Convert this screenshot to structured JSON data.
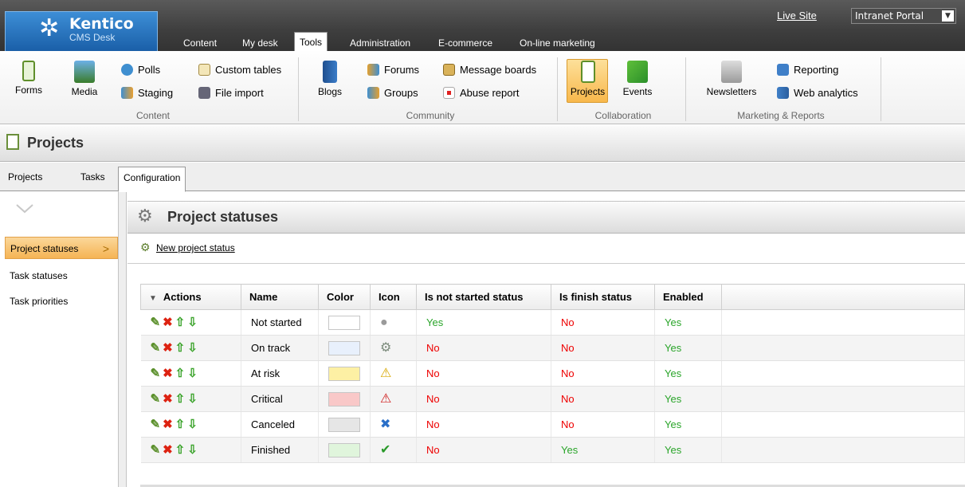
{
  "logo": {
    "name": "Kentico",
    "sub": "CMS Desk"
  },
  "main_tabs": [
    "Content",
    "My desk",
    "Tools",
    "Administration",
    "E-commerce",
    "On-line marketing"
  ],
  "top_right": {
    "live_site": "Live Site",
    "portal": "Intranet Portal"
  },
  "ribbon": {
    "groups": [
      "Content",
      "Community",
      "Collaboration",
      "Marketing & Reports"
    ],
    "content": {
      "forms": "Forms",
      "media": "Media",
      "polls": "Polls",
      "staging": "Staging",
      "custom_tables": "Custom tables",
      "file_import": "File import"
    },
    "community": {
      "blogs": "Blogs",
      "forums": "Forums",
      "groups": "Groups",
      "message_boards": "Message boards",
      "abuse_report": "Abuse report"
    },
    "collaboration": {
      "projects": "Projects",
      "events": "Events"
    },
    "marketing": {
      "newsletters": "Newsletters",
      "reporting": "Reporting",
      "web_analytics": "Web analytics"
    }
  },
  "page": {
    "title": "Projects"
  },
  "sub_tabs": [
    "Projects",
    "Tasks",
    "Configuration"
  ],
  "left_nav": [
    "Project statuses",
    "Task statuses",
    "Task priorities"
  ],
  "content": {
    "title": "Project statuses",
    "new_link": "New project status"
  },
  "grid": {
    "columns": [
      "Actions",
      "Name",
      "Color",
      "Icon",
      "Is not started status",
      "Is finish status",
      "Enabled"
    ],
    "rows": [
      {
        "name": "Not started",
        "color": "#ffffff",
        "icon": "grey-circle-icon",
        "not_started": "Yes",
        "finish": "No",
        "enabled": "Yes"
      },
      {
        "name": "On track",
        "color": "#e8f0fc",
        "icon": "gear-icon",
        "not_started": "No",
        "finish": "No",
        "enabled": "Yes"
      },
      {
        "name": "At risk",
        "color": "#fdf0a4",
        "icon": "warning-icon",
        "not_started": "No",
        "finish": "No",
        "enabled": "Yes"
      },
      {
        "name": "Critical",
        "color": "#f9c8c8",
        "icon": "critical-warning-icon",
        "not_started": "No",
        "finish": "No",
        "enabled": "Yes"
      },
      {
        "name": "Canceled",
        "color": "#e6e6e6",
        "icon": "blue-x-icon",
        "not_started": "No",
        "finish": "No",
        "enabled": "Yes"
      },
      {
        "name": "Finished",
        "color": "#e0f5dc",
        "icon": "checkmark-icon",
        "not_started": "No",
        "finish": "Yes",
        "enabled": "Yes"
      }
    ]
  }
}
